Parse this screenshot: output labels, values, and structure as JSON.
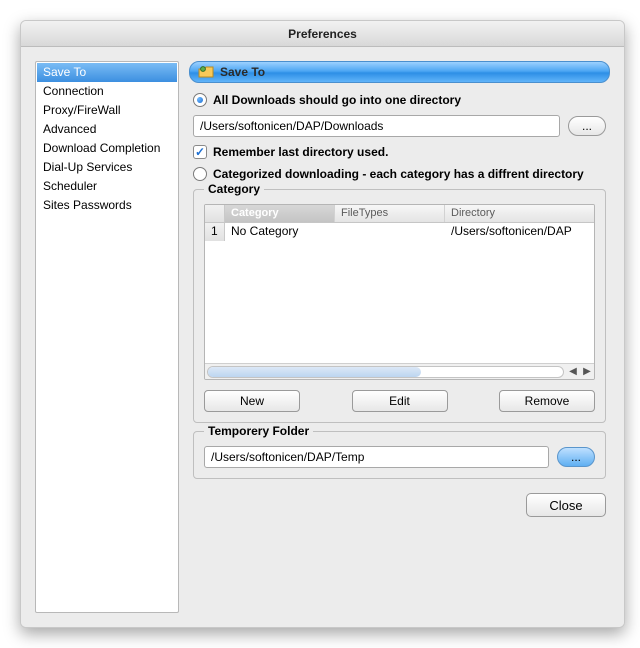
{
  "window": {
    "title": "Preferences"
  },
  "sidebar": {
    "items": [
      "Save To",
      "Connection",
      "Proxy/FireWall",
      "Advanced",
      "Download Completion",
      "Dial-Up Services",
      "Scheduler",
      "Sites Passwords"
    ],
    "selected_index": 0
  },
  "header": {
    "title": "Save To"
  },
  "option_all": {
    "label": "All Downloads should go into one directory",
    "checked": true
  },
  "path_all": "/Users/softonicen/DAP/Downloads",
  "browse_label": "...",
  "remember": {
    "label": "Remember last directory used.",
    "checked": true
  },
  "option_cat": {
    "label": "Categorized downloading - each category has a diffrent directory",
    "checked": false
  },
  "category_group": {
    "legend": "Category",
    "columns": [
      "Category",
      "FileTypes",
      "Directory"
    ],
    "rows": [
      {
        "n": "1",
        "category": "No Category",
        "filetypes": "",
        "directory": "/Users/softonicen/DAP"
      }
    ],
    "buttons": {
      "new": "New",
      "edit": "Edit",
      "remove": "Remove"
    }
  },
  "temp_group": {
    "legend": "Temporery Folder",
    "path": "/Users/softonicen/DAP/Temp",
    "browse": "..."
  },
  "close": "Close"
}
